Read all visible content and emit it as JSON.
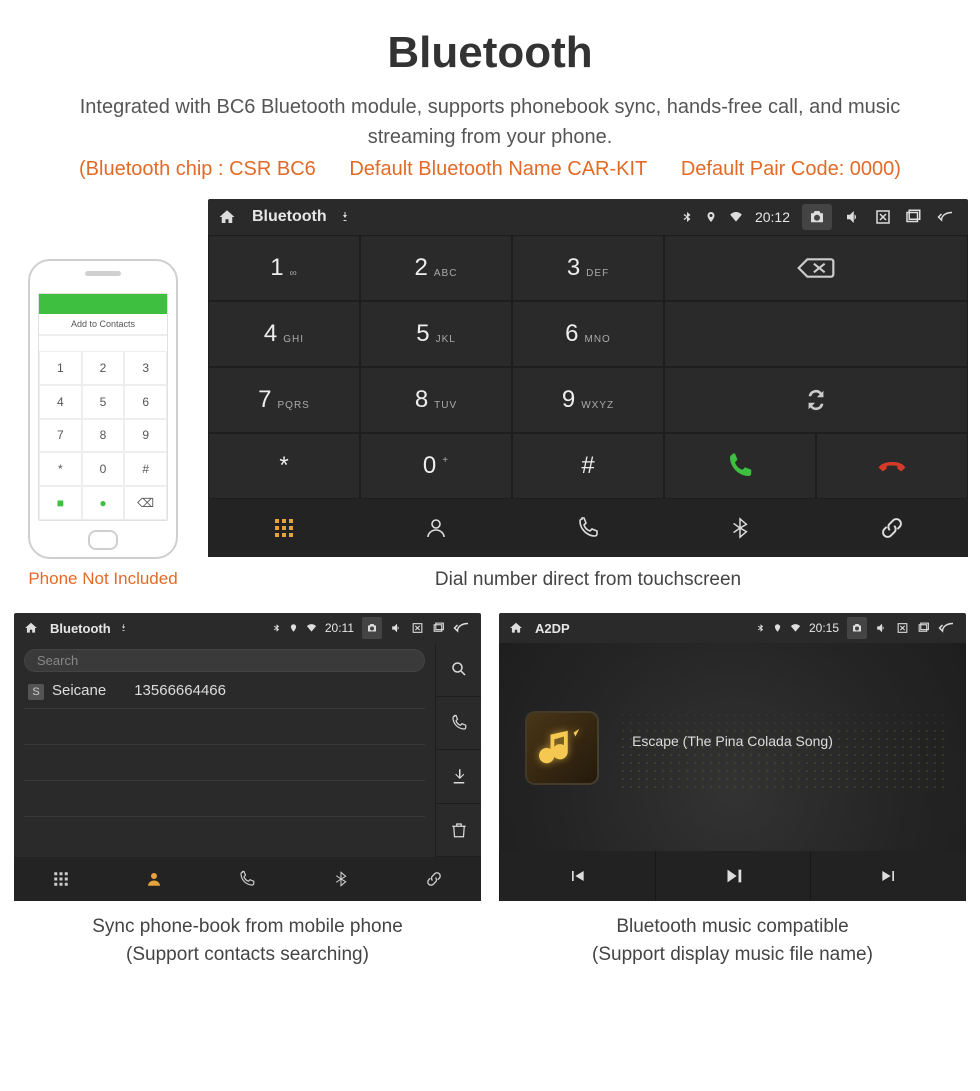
{
  "hero": {
    "title": "Bluetooth",
    "desc": "Integrated with BC6 Bluetooth module, supports phonebook sync, hands-free call, and music streaming from your phone.",
    "spec_chip": "(Bluetooth chip : CSR BC6",
    "spec_name": "Default Bluetooth Name CAR-KIT",
    "spec_code": "Default Pair Code: 0000)"
  },
  "phone": {
    "header": "Add to Contacts",
    "caption": "Phone Not Included"
  },
  "dialer": {
    "status_title": "Bluetooth",
    "time": "20:12",
    "keys": [
      {
        "n": "1",
        "s": "∞"
      },
      {
        "n": "2",
        "s": "ABC"
      },
      {
        "n": "3",
        "s": "DEF"
      },
      {
        "n": "4",
        "s": "GHI"
      },
      {
        "n": "5",
        "s": "JKL"
      },
      {
        "n": "6",
        "s": "MNO"
      },
      {
        "n": "7",
        "s": "PQRS"
      },
      {
        "n": "8",
        "s": "TUV"
      },
      {
        "n": "9",
        "s": "WXYZ"
      },
      {
        "n": "*",
        "s": ""
      },
      {
        "n": "0",
        "s": "+"
      },
      {
        "n": "#",
        "s": ""
      }
    ],
    "caption": "Dial number direct from touchscreen"
  },
  "contacts": {
    "status_title": "Bluetooth",
    "time": "20:11",
    "search_placeholder": "Search",
    "entry_name": "Seicane",
    "entry_number": "13566664466",
    "caption_line1": "Sync phone-book from mobile phone",
    "caption_line2": "(Support contacts searching)"
  },
  "a2dp": {
    "status_title": "A2DP",
    "time": "20:15",
    "track": "Escape (The Pina Colada Song)",
    "caption_line1": "Bluetooth music compatible",
    "caption_line2": "(Support display music file name)"
  }
}
